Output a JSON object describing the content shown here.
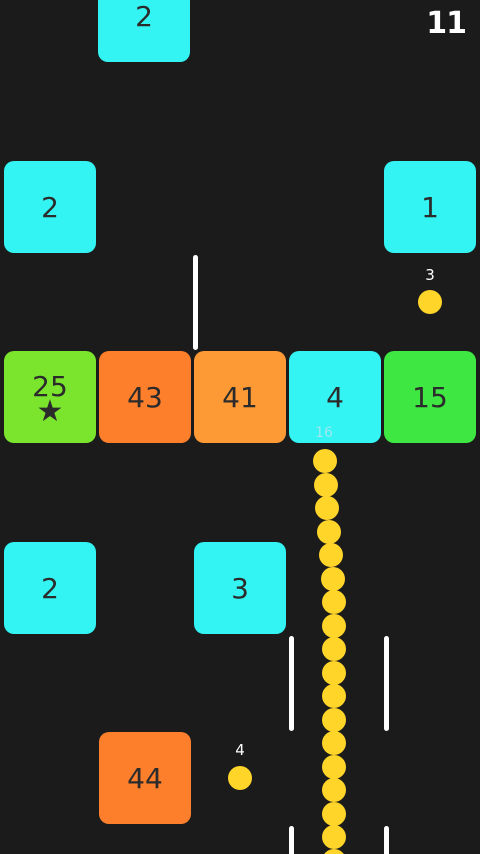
{
  "score": "11",
  "colors": {
    "background": "#1b1b1b",
    "cyan": "#33f4f2",
    "orange_dark": "#fd7f2c",
    "orange": "#fe9a35",
    "lime": "#7be52e",
    "green": "#3fe742",
    "snake": "#ffd52a",
    "wall": "#ffffff"
  },
  "blocks": {
    "top_center": {
      "value": "2",
      "color": "#33f4f2"
    },
    "upper_left": {
      "value": "2",
      "color": "#33f4f2"
    },
    "upper_right": {
      "value": "1",
      "color": "#33f4f2"
    },
    "row": [
      {
        "value": "25",
        "color": "#7be52e",
        "star": "★"
      },
      {
        "value": "43",
        "color": "#fd7f2c"
      },
      {
        "value": "41",
        "color": "#fe9a35"
      },
      {
        "value": "4",
        "color": "#33f4f2"
      },
      {
        "value": "15",
        "color": "#3fe742"
      }
    ],
    "lower_left": {
      "value": "2",
      "color": "#33f4f2"
    },
    "lower_mid": {
      "value": "3",
      "color": "#33f4f2"
    },
    "bottom": {
      "value": "44",
      "color": "#fd7f2c"
    }
  },
  "food": [
    {
      "label": "3"
    },
    {
      "label": "4"
    }
  ],
  "snake": {
    "length_label": "16"
  }
}
